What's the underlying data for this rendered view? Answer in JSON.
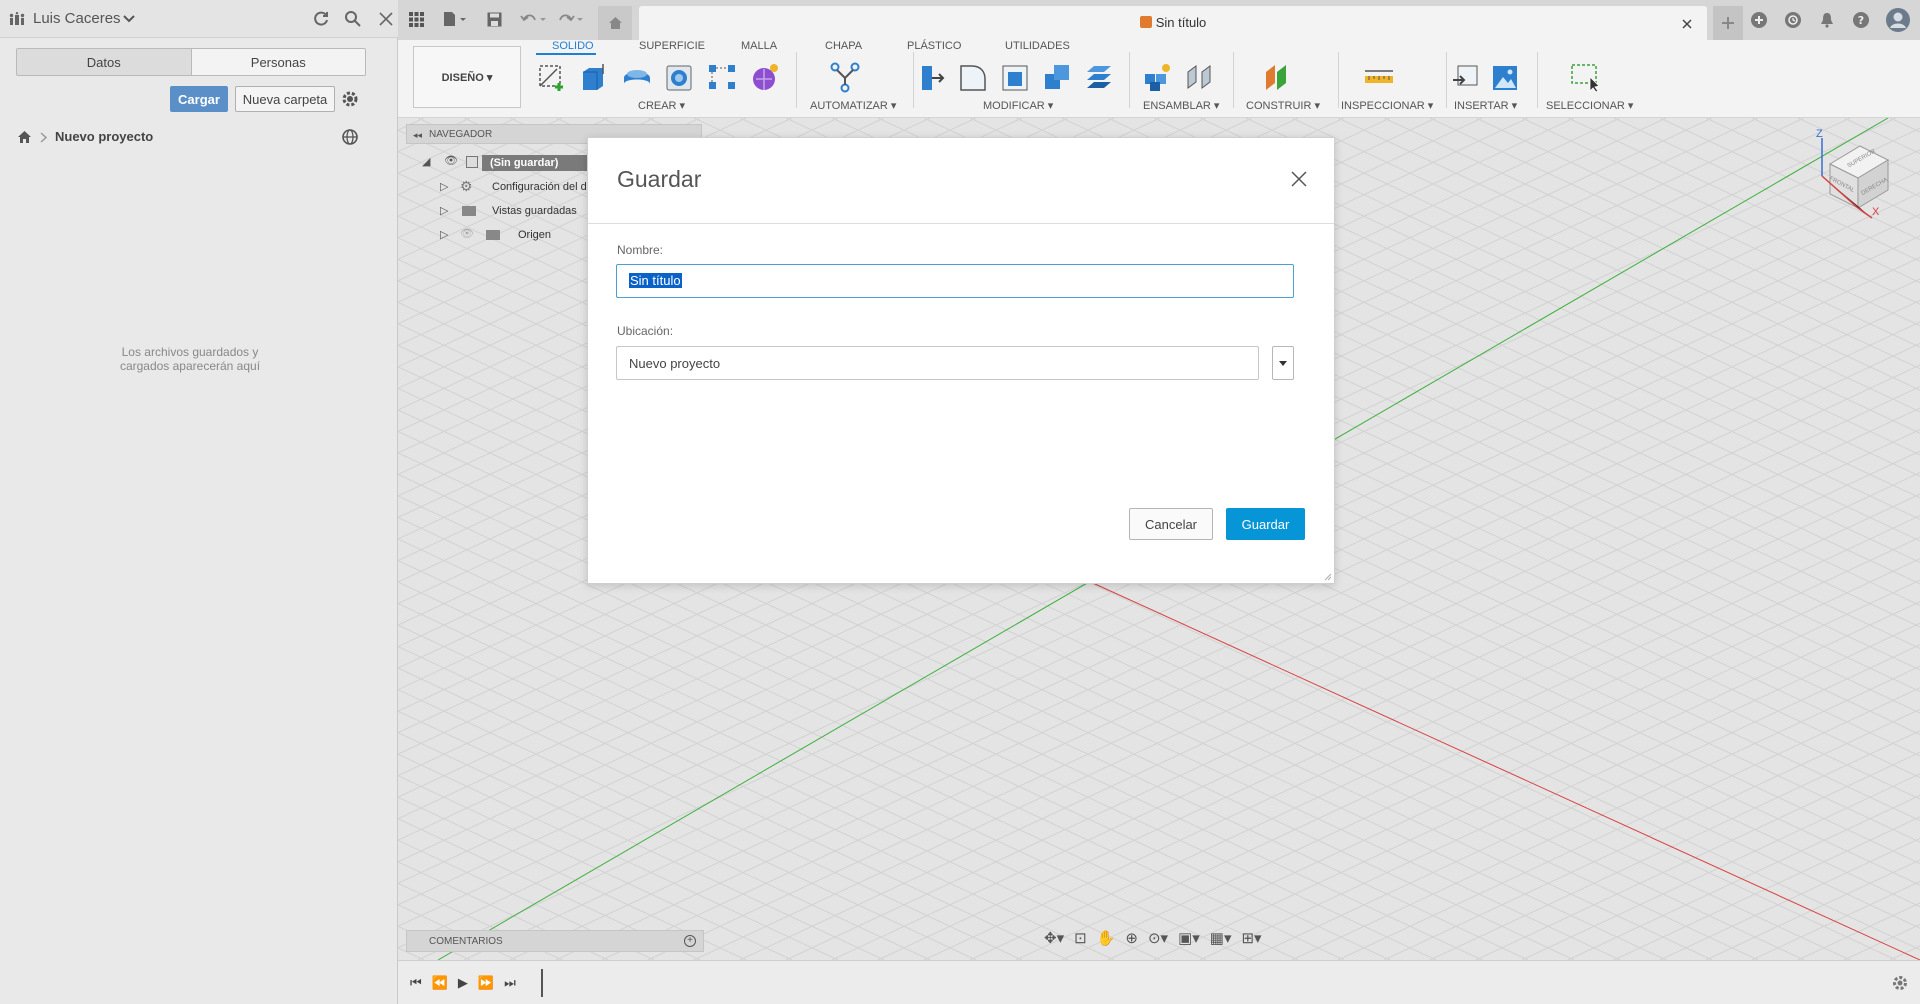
{
  "colors": {
    "accent": "#0696d7",
    "tab_active": "#1d7fd6",
    "cargar_bg": "#5b8fc7",
    "x_axis": "#d84040",
    "y_axis": "#3bb03b"
  },
  "data_panel": {
    "user_name": "Luis Caceres",
    "tabs": [
      {
        "label": "Datos",
        "active": true
      },
      {
        "label": "Personas",
        "active": false
      }
    ],
    "upload_label": "Cargar",
    "new_folder_label": "Nueva carpeta",
    "breadcrumb": "Nuevo proyecto",
    "empty_message_line1": "Los archivos guardados y",
    "empty_message_line2": "cargados aparecerán aquí"
  },
  "document": {
    "title": "Sin título"
  },
  "ribbon": {
    "workspace_label": "DISEÑO ▾",
    "tabs": [
      {
        "label": "SOLIDO",
        "active": true
      },
      {
        "label": "SUPERFICIE",
        "active": false
      },
      {
        "label": "MALLA",
        "active": false
      },
      {
        "label": "CHAPA",
        "active": false
      },
      {
        "label": "PLÁSTICO",
        "active": false
      },
      {
        "label": "UTILIDADES",
        "active": false
      }
    ],
    "groups": [
      "CREAR ▾",
      "AUTOMATIZAR ▾",
      "MODIFICAR ▾",
      "ENSAMBLAR ▾",
      "CONSTRUIR ▾",
      "INSPECCIONAR ▾",
      "INSERTAR ▾",
      "SELECCIONAR ▾"
    ]
  },
  "navigator": {
    "title": "NAVEGADOR",
    "root_label": "(Sin guardar)",
    "items": [
      "Configuración del d",
      "Vistas guardadas",
      "Origen"
    ]
  },
  "viewcube": {
    "top": "SUPERIOR",
    "front": "FRONTAL",
    "right": "DERECHA",
    "axis_z": "Z",
    "axis_x": "X"
  },
  "comments_label": "COMENTARIOS",
  "dialog": {
    "title": "Guardar",
    "name_label": "Nombre:",
    "name_value": "Sin título",
    "location_label": "Ubicación:",
    "location_value": "Nuevo proyecto",
    "cancel_label": "Cancelar",
    "save_label": "Guardar"
  }
}
